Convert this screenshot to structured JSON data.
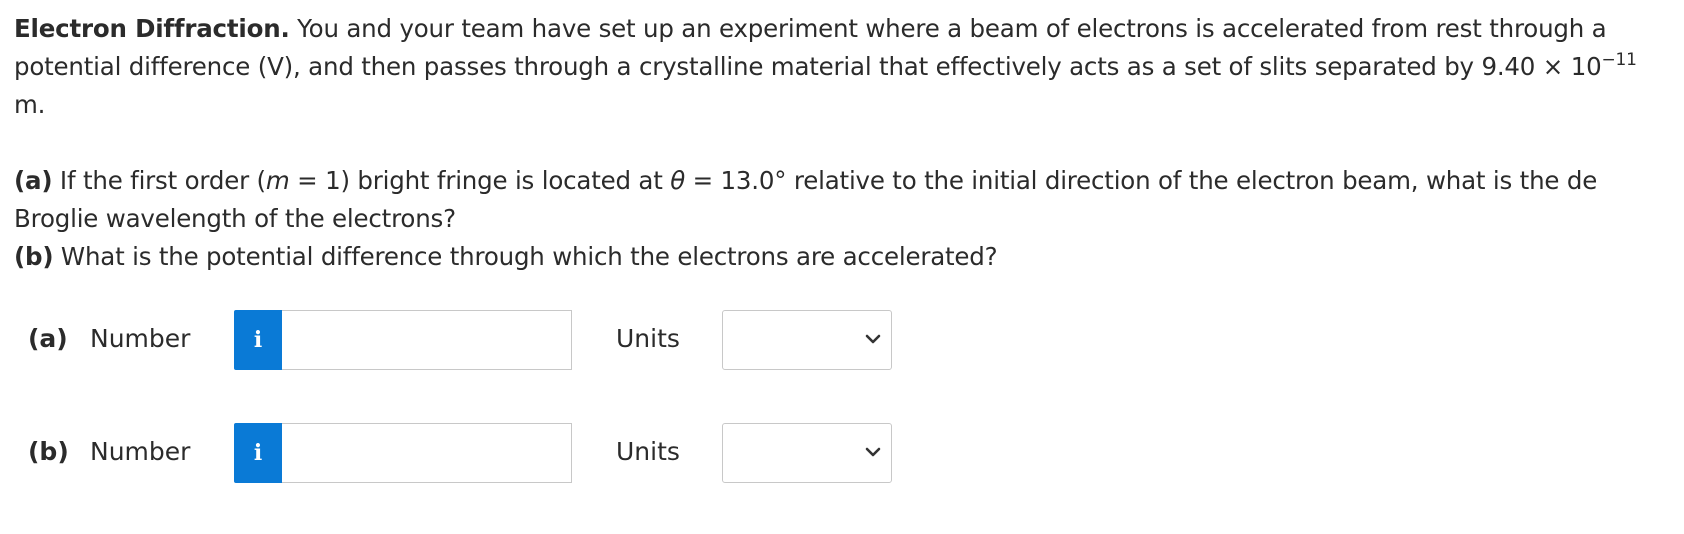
{
  "problem": {
    "title": "Electron Diffraction.",
    "intro_1": "You and your team have set up an experiment where a beam of electrons is accelerated from rest through a potential difference (V), and then passes through a crystalline material that effectively acts as a set of slits separated by 9.40 × 10",
    "exponent": "−11",
    "intro_2": " m.",
    "part_a_label": "(a)",
    "part_a_1": " If the first order (",
    "part_a_m": "m",
    "part_a_2": " = 1) bright fringe is located at ",
    "part_a_theta": "θ",
    "part_a_3": " = 13.0° relative to the initial direction of the electron beam, what is the de Broglie wavelength of the electrons?",
    "part_b_label": "(b)",
    "part_b_text": " What is the potential difference through which the electrons are accelerated?"
  },
  "answers": [
    {
      "part": "(a)",
      "number_label": "Number",
      "info_icon": "i",
      "number_value": "",
      "units_label": "Units",
      "units_value": ""
    },
    {
      "part": "(b)",
      "number_label": "Number",
      "info_icon": "i",
      "number_value": "",
      "units_label": "Units",
      "units_value": ""
    }
  ],
  "colors": {
    "info_button": "#0a7ad6",
    "text": "#2b2b2b",
    "border": "#c8c8c8"
  }
}
